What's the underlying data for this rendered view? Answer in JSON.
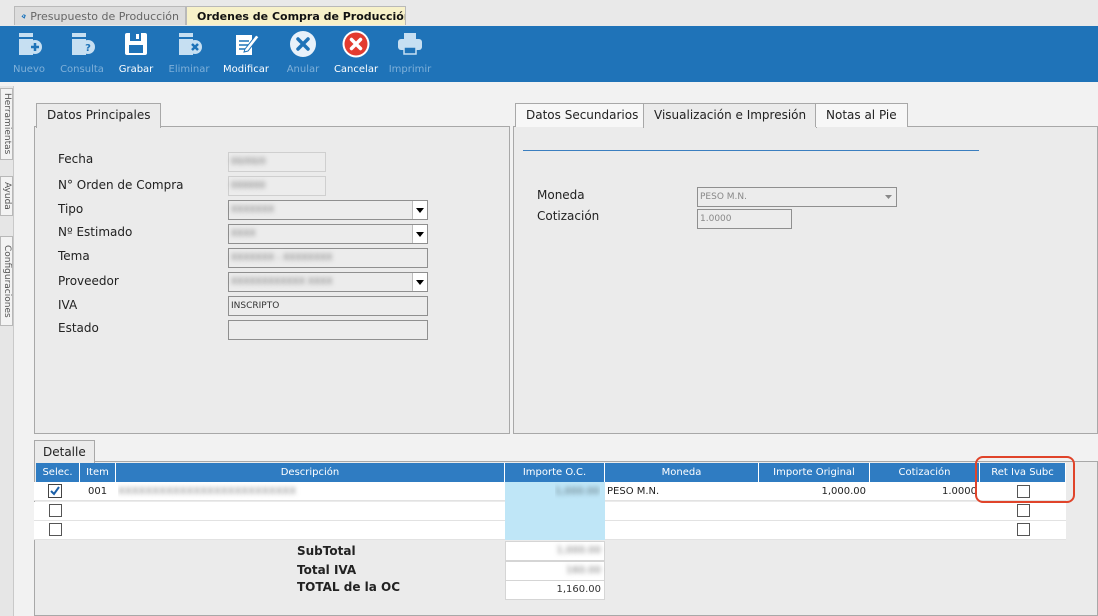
{
  "window_tabs": [
    {
      "label": "Presupuesto de Producción"
    },
    {
      "label": "Ordenes de Compra de Producción"
    }
  ],
  "toolbar": {
    "nuevo": "Nuevo",
    "consulta": "Consulta",
    "grabar": "Grabar",
    "eliminar": "Eliminar",
    "modificar": "Modificar",
    "anular": "Anular",
    "cancelar": "Cancelar",
    "imprimir": "Imprimir"
  },
  "rail": {
    "herramientas": "Herramientas",
    "ayuda": "Ayuda",
    "configuraciones": "Configuraciones"
  },
  "principales": {
    "tab": "Datos Principales",
    "fecha_label": "Fecha",
    "orden_label": "N° Orden de Compra",
    "tipo_label": "Tipo",
    "estimado_label": "Nº Estimado",
    "tema_label": "Tema",
    "proveedor_label": "Proveedor",
    "iva_label": "IVA",
    "iva_value": "INSCRIPTO",
    "estado_label": "Estado",
    "estado_value": ""
  },
  "secundarios": {
    "tab1": "Datos Secundarios",
    "tab2": "Visualización e Impresión",
    "tab3": "Notas al Pie",
    "moneda_label": "Moneda",
    "moneda_value": "PESO M.N.",
    "cotizacion_label": "Cotización",
    "cotizacion_value": "1.0000"
  },
  "detalle": {
    "tab": "Detalle",
    "columns": {
      "selec": "Selec.",
      "item": "Item",
      "descripcion": "Descripción",
      "importe_oc": "Importe O.C.",
      "moneda": "Moneda",
      "importe_original": "Importe Original",
      "cotizacion": "Cotización",
      "ret_iva": "Ret Iva Subc"
    },
    "row1": {
      "item": "001",
      "moneda": "PESO M.N.",
      "importe_original": "1,000.00",
      "cotizacion": "1.0000",
      "selected": true
    },
    "subtotal_label": "SubTotal",
    "total_iva_label": "Total IVA",
    "total_oc_label": "TOTAL de la OC",
    "total_oc_value": "1,160.00"
  },
  "colors": {
    "toolbar": "#1f73b8",
    "grid_header": "#2f7cc2",
    "highlight": "#e0442a"
  }
}
